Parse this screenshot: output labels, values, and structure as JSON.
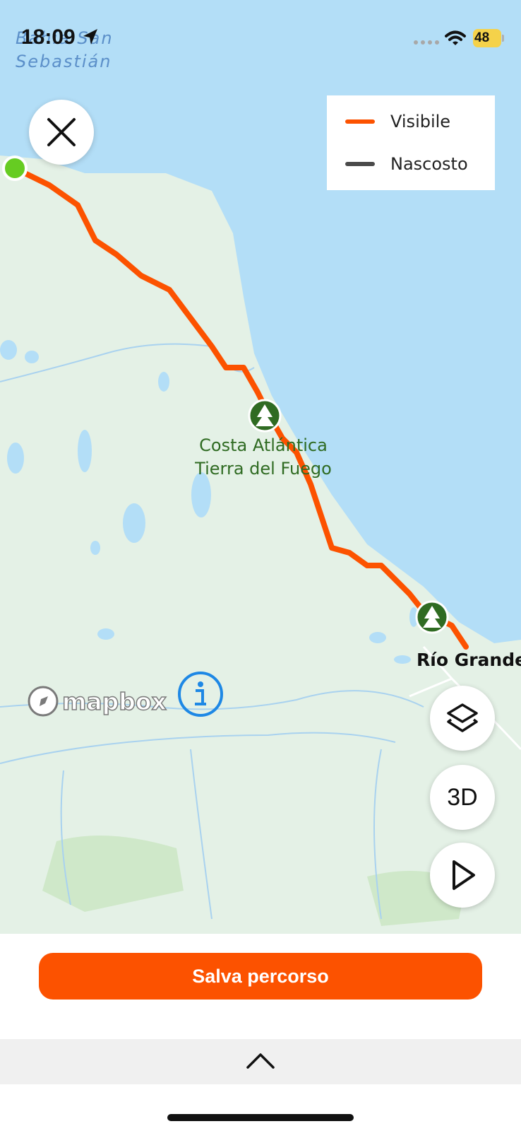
{
  "status_bar": {
    "time": "18:09",
    "battery": "48"
  },
  "map": {
    "bay_label": "Bahía San Sebastián",
    "park_label": "Costa Atlántica Tierra del Fuego",
    "city_label": "Río Grande",
    "attribution": "mapbox",
    "colors": {
      "water": "#b3def7",
      "land": "#e4f1e6",
      "route": "#fc5200",
      "start": "#66cc22",
      "park_marker": "#2f6b22"
    }
  },
  "legend": {
    "items": [
      {
        "label": "Visibile",
        "color": "#fc5200"
      },
      {
        "label": "Nascosto",
        "color": "#4a4a4a"
      }
    ]
  },
  "controls": {
    "close_icon": "close-icon",
    "layers_icon": "layers-icon",
    "three_d_label": "3D",
    "play_icon": "play-icon",
    "info_icon": "info-icon"
  },
  "bottom": {
    "save_label": "Salva percorso",
    "handle_icon": "chevron-up-icon"
  }
}
